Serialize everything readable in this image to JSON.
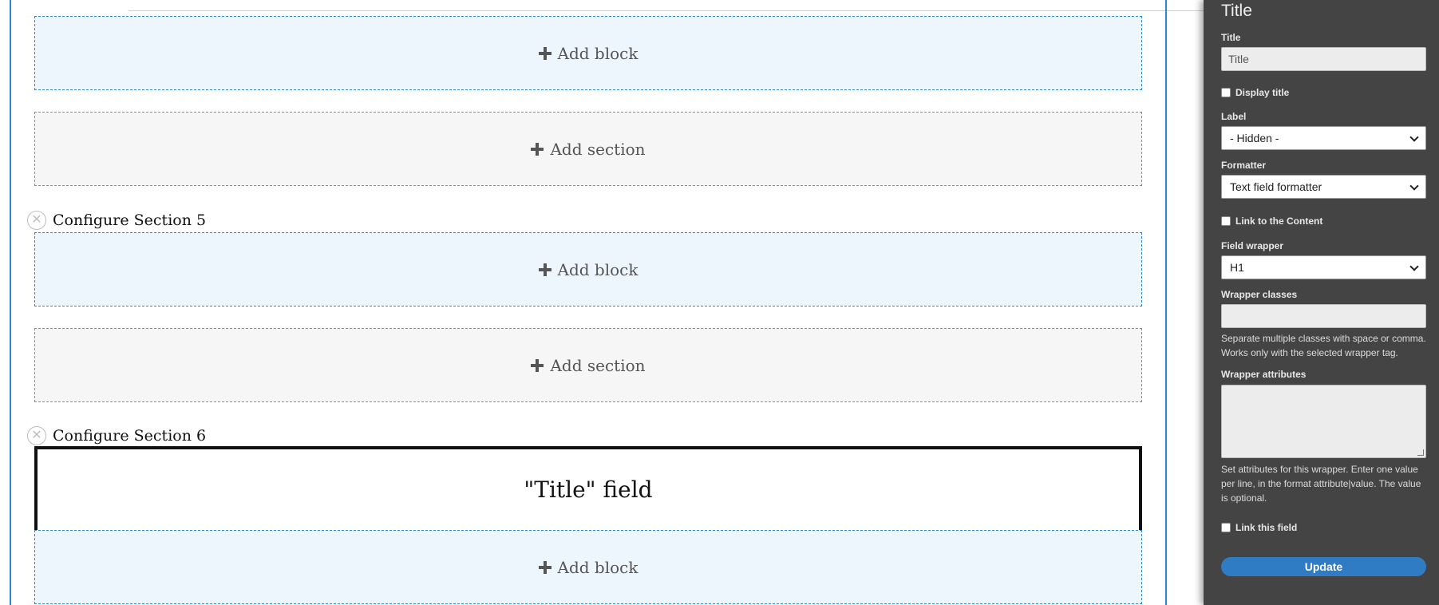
{
  "canvas": {
    "add_block_label": "Add block",
    "add_section_label": "Add section",
    "sections": [
      {
        "configure_label": "Configure Section 5",
        "remove_glyph": "✕"
      },
      {
        "configure_label": "Configure Section 6",
        "remove_glyph": "✕"
      }
    ],
    "title_field_block": "\"Title\" field"
  },
  "sidebar": {
    "heading": "Title",
    "title_label": "Title",
    "title_value": "Title",
    "display_title_label": "Display title",
    "label_label": "Label",
    "label_selected": "- Hidden -",
    "formatter_label": "Formatter",
    "formatter_selected": "Text field formatter",
    "link_to_content_label": "Link to the Content",
    "field_wrapper_label": "Field wrapper",
    "field_wrapper_selected": "H1",
    "wrapper_classes_label": "Wrapper classes",
    "wrapper_classes_value": "",
    "wrapper_classes_help": "Separate multiple classes with space or comma. Works only with the selected wrapper tag.",
    "wrapper_attributes_label": "Wrapper attributes",
    "wrapper_attributes_help": "Set attributes for this wrapper. Enter one value per line, in the format attribute|value. The value is optional.",
    "link_this_field_label": "Link this field",
    "update_label": "Update"
  },
  "colors": {
    "accent": "#2a87d0",
    "sidebar_bg": "#444444",
    "add_block_bg": "#eef6fd",
    "add_section_bg": "#f6f6f6",
    "button": "#2f7cc4"
  },
  "icons": {
    "plus": "plus-icon",
    "remove": "close-icon",
    "select_arrow": "chevron-down-icon"
  }
}
